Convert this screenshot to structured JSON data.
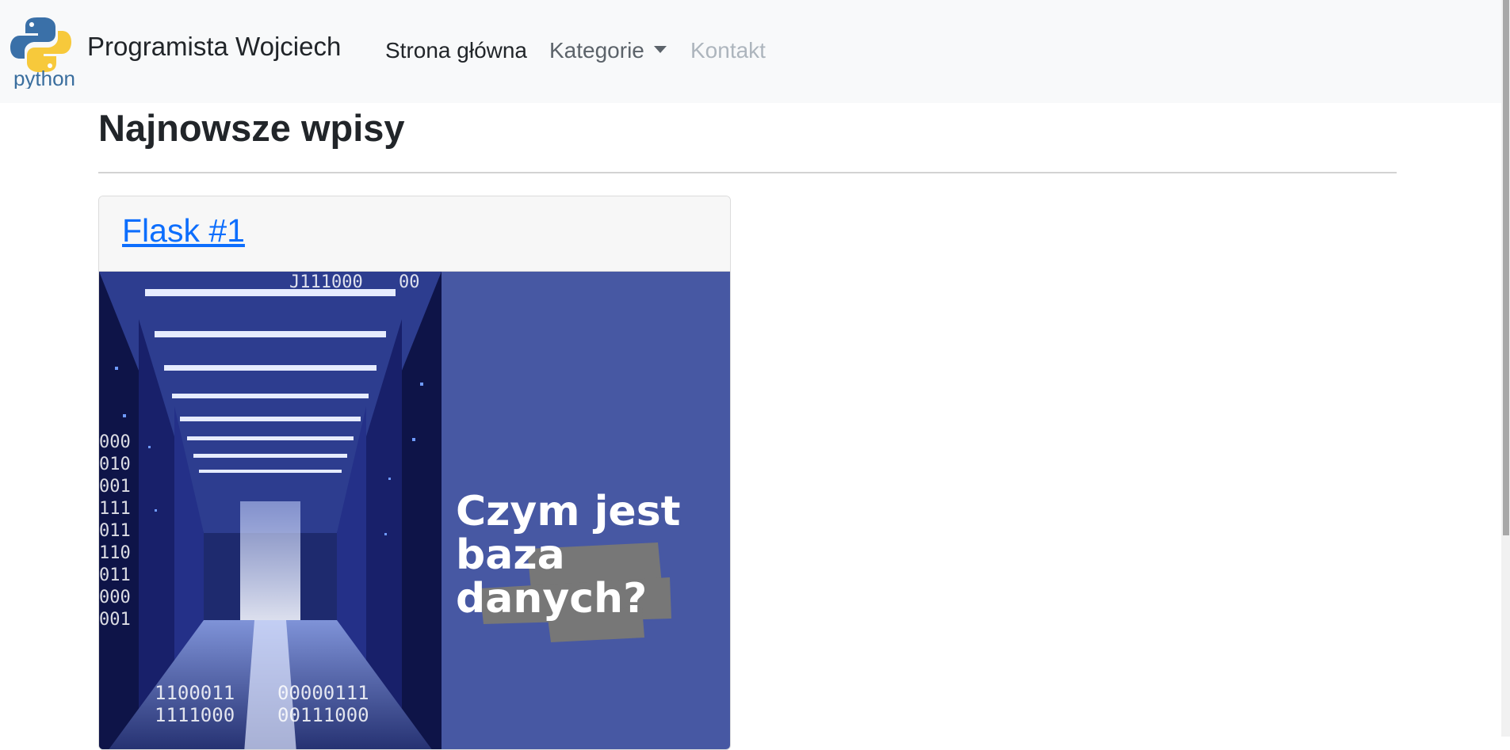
{
  "navbar": {
    "brand_logo_text": "python",
    "brand_name": "Programista Wojciech",
    "items": [
      {
        "label": "Strona główna",
        "state": "active"
      },
      {
        "label": "Kategorie",
        "state": "dropdown"
      },
      {
        "label": "Kontakt",
        "state": "disabled"
      }
    ]
  },
  "main": {
    "heading": "Najnowsze wpisy",
    "posts": [
      {
        "title": "Flask #1",
        "image": {
          "headline_lines": [
            "Czym jest",
            "baza",
            "danych?"
          ],
          "binary_text": [
            "J111000",
            "00",
            "000",
            "010",
            "001",
            "111",
            "011",
            "110",
            "011",
            "000",
            "001",
            "1100011",
            "1111000",
            "00000111",
            "00111000"
          ]
        }
      }
    ]
  },
  "colors": {
    "navbar_bg": "#f8f9fa",
    "link": "#0d6efd",
    "image_panel": "#4758a3",
    "image_server": "#1e2a6e",
    "highlight_stroke": "#777777"
  },
  "icons": {
    "brand": "python-logo-icon",
    "dropdown": "caret-down-icon"
  }
}
